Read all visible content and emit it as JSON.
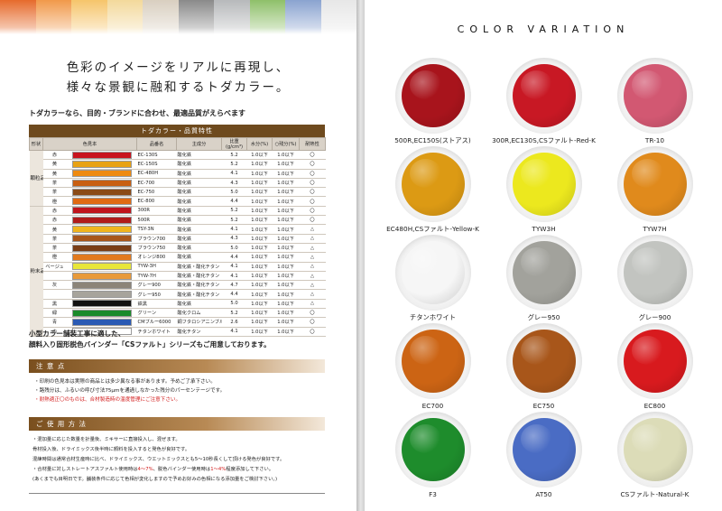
{
  "strip_colors": [
    "#e66b2c",
    "#f19a4a",
    "#f6c56b",
    "#f3d99c",
    "#d9cfc0",
    "#8a8a8a",
    "#b7b9bb",
    "#8fc06a",
    "#8aa3d0",
    "#e7e7e7"
  ],
  "heading": {
    "line1": "色彩のイメージをリアルに再現し、",
    "line2": "様々な景観に融和するトダカラー。"
  },
  "intro": "トダカラーなら、目的・ブランドに合わせ、最適品質がえらべます",
  "table": {
    "title": "トダカラー・品質特性",
    "headers": [
      "形状",
      "色見本",
      "",
      "品番名",
      "主成分",
      "比重(g/cm³)",
      "水分(%)",
      "○残分(%)",
      "耐熱性"
    ],
    "groups": [
      {
        "label": "顆粒品",
        "rows": [
          {
            "color_name": "赤",
            "swatch": "#c8141e",
            "code": "EC-130S",
            "component": "酸化鉄",
            "sg": "5.2",
            "water": "1.0以下",
            "residue": "1.0以下",
            "heat": "〇"
          },
          {
            "color_name": "黄",
            "swatch": "#e8a214",
            "code": "EC-150S",
            "component": "酸化鉄",
            "sg": "5.2",
            "water": "1.0以下",
            "residue": "1.0以下",
            "heat": "〇"
          },
          {
            "color_name": "黄",
            "swatch": "#ee8a10",
            "code": "EC-480H",
            "component": "酸化鉄",
            "sg": "4.1",
            "water": "1.0以下",
            "residue": "1.0以下",
            "heat": "〇"
          },
          {
            "color_name": "茶",
            "swatch": "#c85f12",
            "code": "EC-700",
            "component": "酸化鉄",
            "sg": "4.3",
            "water": "1.0以下",
            "residue": "1.0以下",
            "heat": "〇"
          },
          {
            "color_name": "茶",
            "swatch": "#8a4a16",
            "code": "EC-750",
            "component": "酸化鉄",
            "sg": "5.0",
            "water": "1.0以下",
            "residue": "1.0以下",
            "heat": "〇"
          },
          {
            "color_name": "橙",
            "swatch": "#e06a12",
            "code": "EC-800",
            "component": "酸化鉄",
            "sg": "4.4",
            "water": "1.0以下",
            "residue": "1.0以下",
            "heat": "〇"
          }
        ]
      },
      {
        "label": "粉末品",
        "rows": [
          {
            "color_name": "赤",
            "swatch": "#c0141c",
            "code": "300R",
            "component": "酸化鉄",
            "sg": "5.2",
            "water": "1.0以下",
            "residue": "1.0以下",
            "heat": "〇"
          },
          {
            "color_name": "赤",
            "swatch": "#b01a1a",
            "code": "500R",
            "component": "酸化鉄",
            "sg": "5.2",
            "water": "1.0以下",
            "residue": "1.0以下",
            "heat": "〇"
          },
          {
            "color_name": "黄",
            "swatch": "#f0b41e",
            "code": "TSY-3N",
            "component": "酸化鉄",
            "sg": "4.1",
            "water": "1.0以下",
            "residue": "1.0以下",
            "heat": "△"
          },
          {
            "color_name": "茶",
            "swatch": "#a8561a",
            "code": "ブラウン700",
            "component": "酸化鉄",
            "sg": "4.3",
            "water": "1.0以下",
            "residue": "1.0以下",
            "heat": "△"
          },
          {
            "color_name": "茶",
            "swatch": "#7a3e16",
            "code": "ブラウン750",
            "component": "酸化鉄",
            "sg": "5.0",
            "water": "1.0以下",
            "residue": "1.0以下",
            "heat": "△"
          },
          {
            "color_name": "橙",
            "swatch": "#e27a1e",
            "code": "オレンジ800",
            "component": "酸化鉄",
            "sg": "4.4",
            "water": "1.0以下",
            "residue": "1.0以下",
            "heat": "△"
          },
          {
            "color_name": "ベージュ",
            "swatch": "#e8e63a",
            "code": "TYW-3H",
            "component": "酸化鉄・酸化チタン",
            "sg": "4.1",
            "water": "1.0以下",
            "residue": "1.0以下",
            "heat": "△"
          },
          {
            "color_name": "",
            "swatch": "#e89a3a",
            "code": "TYW-7H",
            "component": "酸化鉄・酸化チタン",
            "sg": "4.1",
            "water": "1.0以下",
            "residue": "1.0以下",
            "heat": "△"
          },
          {
            "color_name": "灰",
            "swatch": "#8c8478",
            "code": "グレー900",
            "component": "酸化鉄・酸化チタン",
            "sg": "4.7",
            "water": "1.0以下",
            "residue": "1.0以下",
            "heat": "△"
          },
          {
            "color_name": "",
            "swatch": "#a7a49c",
            "code": "グレー950",
            "component": "酸化鉄・酸化チタン",
            "sg": "4.4",
            "water": "1.0以下",
            "residue": "1.0以下",
            "heat": "△"
          },
          {
            "color_name": "黒",
            "swatch": "#111111",
            "code": "鉄黒",
            "component": "酸化鉄",
            "sg": "5.0",
            "water": "1.0以下",
            "residue": "1.0以下",
            "heat": "△"
          },
          {
            "color_name": "緑",
            "swatch": "#1a8a2a",
            "code": "グリーン",
            "component": "酸化クロム",
            "sg": "5.2",
            "water": "1.0以下",
            "residue": "1.0以下",
            "heat": "〇"
          },
          {
            "color_name": "青",
            "swatch": "#2a5ab4",
            "code": "CMブルー6000",
            "component": "銅フタロシアニンブルー",
            "sg": "2.6",
            "water": "1.0以下",
            "residue": "1.0以下",
            "heat": "〇"
          },
          {
            "color_name": "白",
            "swatch": "#ffffff",
            "code": "チタンホワイト",
            "component": "酸化チタン",
            "sg": "4.1",
            "water": "1.0以下",
            "residue": "1.0以下",
            "heat": "〇"
          }
        ]
      }
    ]
  },
  "mid_text": {
    "line1": "小型カラー舗装工事に適した、",
    "line2": "顔料入り固形脱色バインダー「CSファルト」シリーズもご用意しております。"
  },
  "caution": {
    "title": "注 意 点",
    "lines": [
      "・印刷の色見本は実際の商品とは多少異なる事があります。予めご了承下さい。",
      "・路残分は、ふるいの呼び寸法75μmを通過しなかった残分のパーセンテージです。"
    ],
    "red_line": "・耐熱適正〇のものは、合材製造時の温度管理にご注意下さい。"
  },
  "usage": {
    "title": "ご 使 用 方 法",
    "lines": [
      "・混加量に応じた数量を計量後、ミキサーに直接投入し、混ぜます。",
      "  骨材投入後、ドライミックス後半時に顔料を投入すると発色が良好です。",
      "  混練時間は通常合材生産時に比べ、ドライミックス、ウエットミックスとも5〜10秒長くして頂ける発色が良好です。",
      "・合材量に対しストレートアスファルト使用時は4〜7%、脱色バインダー使用時は1〜4%程度添加して下さい。",
      "  (あくまでも目明日です。舗装条件に応じて色相が変化しますので予めお好みの色相になる添加量をご検討下さい。)"
    ]
  },
  "color_variation": {
    "title": "COLOR VARIATION",
    "items": [
      {
        "label": "500R,EC150S(ストアス)",
        "color": "#a8141c"
      },
      {
        "label": "300R,EC130S,CSファルト-Red-K",
        "color": "#c81824"
      },
      {
        "label": "TR-10",
        "color": "#d25872"
      },
      {
        "label": "EC480H,CSファルト-Yellow-K",
        "color": "#dc9a14"
      },
      {
        "label": "TYW3H",
        "color": "#ece81e"
      },
      {
        "label": "TYW7H",
        "color": "#e08a1c"
      },
      {
        "label": "チタンホワイト",
        "color": "#f6f6f6"
      },
      {
        "label": "グレー950",
        "color": "#a2a29c"
      },
      {
        "label": "グレー900",
        "color": "#c2c4c0"
      },
      {
        "label": "EC700",
        "color": "#cc6414"
      },
      {
        "label": "EC750",
        "color": "#a8561a"
      },
      {
        "label": "EC800",
        "color": "#d81a1e"
      },
      {
        "label": "F3",
        "color": "#1e8c2c"
      },
      {
        "label": "AT50",
        "color": "#4a6cc4"
      },
      {
        "label": "CSファルト-Natural-K",
        "color": "#dcdcb8"
      }
    ]
  }
}
